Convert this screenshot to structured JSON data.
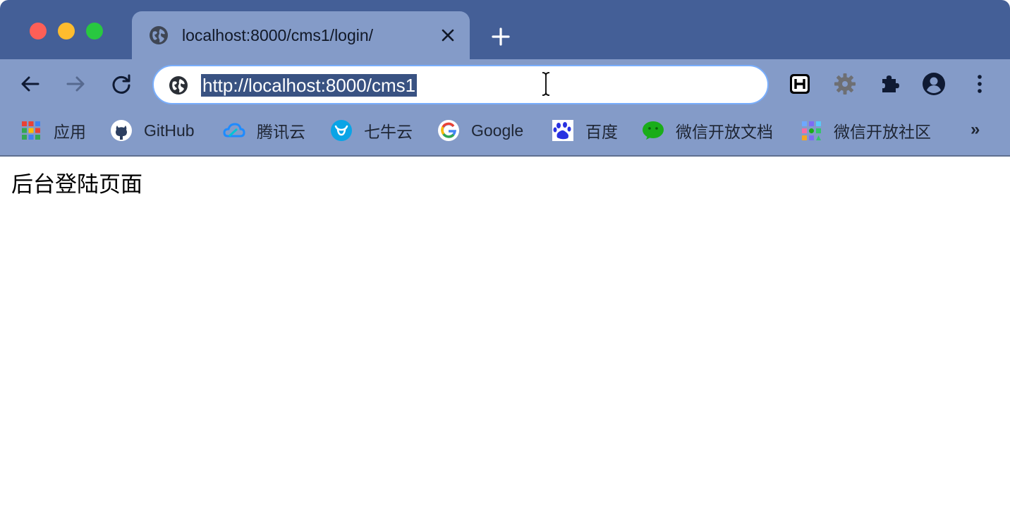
{
  "tab": {
    "title": "localhost:8000/cms1/login/",
    "favicon": "globe-icon"
  },
  "omnibox": {
    "url_text": "http://localhost:8000/cms1",
    "icon": "globe-icon"
  },
  "toolbar": {
    "back": "back-arrow-icon",
    "forward": "forward-arrow-icon",
    "reload": "reload-icon",
    "extensions": [
      "h-extension-icon",
      "gear-extension-icon",
      "puzzle-icon",
      "profile-icon",
      "kebab-menu-icon"
    ]
  },
  "bookmarks": {
    "items": [
      {
        "label": "应用",
        "icon": "apps-grid-icon"
      },
      {
        "label": "GitHub",
        "icon": "github-icon"
      },
      {
        "label": "腾讯云",
        "icon": "tencent-cloud-icon"
      },
      {
        "label": "七牛云",
        "icon": "qiniu-icon"
      },
      {
        "label": "Google",
        "icon": "google-icon"
      },
      {
        "label": "百度",
        "icon": "baidu-icon"
      },
      {
        "label": "微信开放文档",
        "icon": "wechat-icon"
      },
      {
        "label": "微信开放社区",
        "icon": "wechat-community-icon"
      }
    ],
    "more": "»"
  },
  "page": {
    "text": "后台登陆页面"
  },
  "colors": {
    "tabstrip": "#445f97",
    "toolbar": "#849bc8",
    "omnibox_border": "#79aefc",
    "selection": "#395282"
  }
}
